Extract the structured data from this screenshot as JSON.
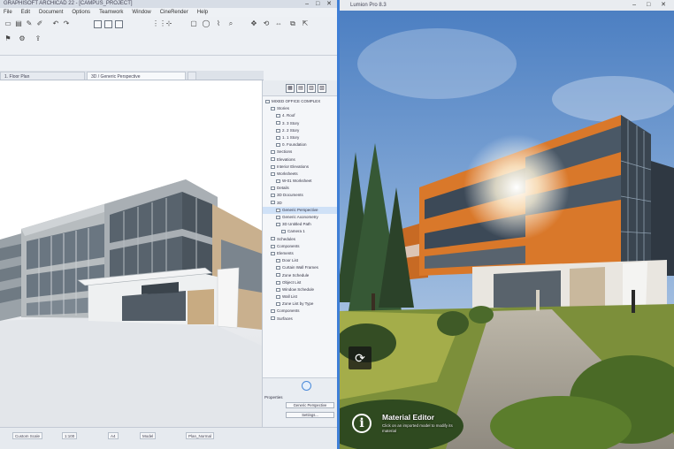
{
  "left_window": {
    "title": "GRAPHISOFT ARCHICAD 22 - [CAMPUS_PROJECT]",
    "menu": [
      "File",
      "Edit",
      "Document",
      "Options",
      "Teamwork",
      "Window",
      "CineRender",
      "Help"
    ],
    "tabs": [
      "1. Floor Plan",
      "3D / Generic Perspective",
      ""
    ],
    "navigator": {
      "items": [
        {
          "label": "MIXED OFFICE COMPLEX",
          "indent": 0
        },
        {
          "label": "Stories",
          "indent": 1
        },
        {
          "label": "4. Roof",
          "indent": 2
        },
        {
          "label": "3. 3 Story",
          "indent": 2
        },
        {
          "label": "2. 2 Story",
          "indent": 2
        },
        {
          "label": "1. 1 Story",
          "indent": 2
        },
        {
          "label": "0. Foundation",
          "indent": 2
        },
        {
          "label": "Sections",
          "indent": 1
        },
        {
          "label": "Elevations",
          "indent": 1
        },
        {
          "label": "Interior Elevations",
          "indent": 1
        },
        {
          "label": "Worksheets",
          "indent": 1
        },
        {
          "label": "W-01 Worksheet",
          "indent": 2
        },
        {
          "label": "Details",
          "indent": 1
        },
        {
          "label": "3D Documents",
          "indent": 1
        },
        {
          "label": "3D",
          "indent": 1
        },
        {
          "label": "Generic Perspective",
          "indent": 2,
          "selected": true
        },
        {
          "label": "Generic Axonometry",
          "indent": 2
        },
        {
          "label": "3D Untitled Path",
          "indent": 2
        },
        {
          "label": "Camera 1",
          "indent": 3
        },
        {
          "label": "Schedules",
          "indent": 1
        },
        {
          "label": "Components",
          "indent": 1
        },
        {
          "label": "Elements",
          "indent": 1
        },
        {
          "label": "Door List",
          "indent": 2
        },
        {
          "label": "Curtain Wall Frames",
          "indent": 2
        },
        {
          "label": "Zone Schedule",
          "indent": 2
        },
        {
          "label": "Object List",
          "indent": 2
        },
        {
          "label": "Window Schedule",
          "indent": 2
        },
        {
          "label": "Wall List",
          "indent": 2
        },
        {
          "label": "Zone List by Type",
          "indent": 2
        },
        {
          "label": "Components",
          "indent": 1
        },
        {
          "label": "Surfaces",
          "indent": 1
        }
      ],
      "footer_label": "Properties",
      "footer_buttons": [
        "Generic Perspective",
        "Settings..."
      ]
    },
    "status": [
      "Custom Scale",
      "1:100",
      "A4",
      "Model",
      "Plan_Normal"
    ]
  },
  "right_window": {
    "title": "Lumion Pro 8.3",
    "material_editor": {
      "title": "Material Editor",
      "subtitle": "Click on an imported model to modify its material"
    }
  },
  "colors": {
    "accent": "#3f7fd6",
    "facade_orange": "#d9782a"
  }
}
